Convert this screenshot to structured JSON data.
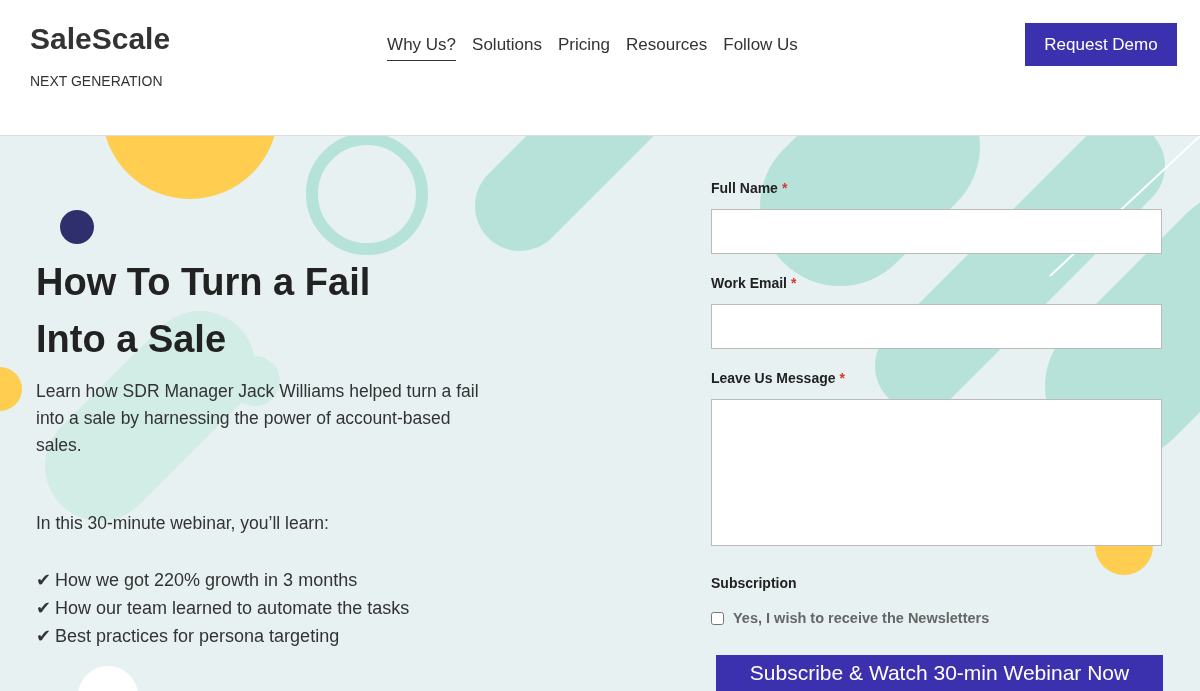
{
  "header": {
    "logo": "SaleScale",
    "tagline": "NEXT GENERATION",
    "nav": [
      {
        "label": "Why Us?",
        "selected": true
      },
      {
        "label": "Solutions",
        "selected": false
      },
      {
        "label": "Pricing",
        "selected": false
      },
      {
        "label": "Resources",
        "selected": false
      },
      {
        "label": "Follow Us",
        "selected": false
      }
    ],
    "cta": "Request Demo"
  },
  "hero": {
    "title": "How To Turn a Fail Into a Sale",
    "description": "Learn how SDR Manager Jack Williams helped turn a fail into a sale by harnessing the power of account-based sales.",
    "intro": "In this 30-minute webinar, you’ll learn:",
    "points": [
      {
        "mark": "✔",
        "text": "How we got 220% growth in 3 months"
      },
      {
        "mark": "✔",
        "text": "How our team learned to automate the tasks"
      },
      {
        "mark": "✔",
        "text": "Best practices for persona targeting"
      }
    ]
  },
  "form": {
    "fields": [
      {
        "kind": "text",
        "label": "Full Name",
        "required_mark": "*"
      },
      {
        "kind": "text",
        "label": "Work Email",
        "required_mark": "*"
      },
      {
        "kind": "textarea",
        "label": "Leave Us Message",
        "required_mark": "*"
      }
    ],
    "subscription": {
      "heading": "Subscription",
      "option": "Yes, I wish to receive the Newsletters",
      "checked": false
    },
    "submit": "Subscribe & Watch 30-min Webinar Now"
  }
}
